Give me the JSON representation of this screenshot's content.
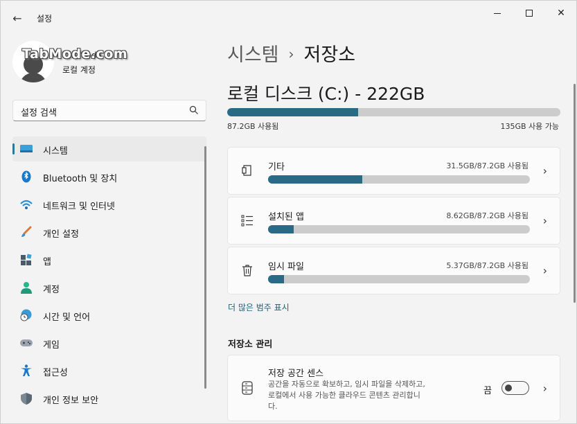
{
  "window": {
    "title": "설정",
    "back_glyph": "←",
    "close_glyph": "✕"
  },
  "profile": {
    "name": "Tab.Mode",
    "account_type": "로컬 계정",
    "watermark": "TabMode.com"
  },
  "search": {
    "placeholder": "설정 검색"
  },
  "sidebar": {
    "items": [
      {
        "label": "시스템",
        "icon": "monitor-icon",
        "active": true
      },
      {
        "label": "Bluetooth 및 장치",
        "icon": "bluetooth-icon"
      },
      {
        "label": "네트워크 및 인터넷",
        "icon": "wifi-icon"
      },
      {
        "label": "개인 설정",
        "icon": "brush-icon"
      },
      {
        "label": "앱",
        "icon": "apps-icon"
      },
      {
        "label": "계정",
        "icon": "person-icon"
      },
      {
        "label": "시간 및 언어",
        "icon": "globe-clock-icon"
      },
      {
        "label": "게임",
        "icon": "gamepad-icon"
      },
      {
        "label": "접근성",
        "icon": "accessibility-icon"
      },
      {
        "label": "개인 정보 보안",
        "icon": "shield-icon"
      }
    ]
  },
  "breadcrumb": {
    "parent": "시스템",
    "separator": "›",
    "current": "저장소"
  },
  "disk": {
    "title": "로컬 디스크 (C:) - 222GB",
    "used_label": "87.2GB 사용됨",
    "free_label": "135GB 사용 가능",
    "used_fraction": 0.393
  },
  "categories": [
    {
      "title": "기타",
      "usage": "31.5GB/87.2GB 사용됨",
      "fraction": 0.361,
      "icon": "document-icon"
    },
    {
      "title": "설치된 앱",
      "usage": "8.62GB/87.2GB 사용됨",
      "fraction": 0.099,
      "icon": "list-icon"
    },
    {
      "title": "임시 파일",
      "usage": "5.37GB/87.2GB 사용됨",
      "fraction": 0.062,
      "icon": "trash-icon"
    }
  ],
  "more_categories_label": "더 많은 범주 표시",
  "storage_management": {
    "section_title": "저장소 관리",
    "sense": {
      "title": "저장 공간 센스",
      "description": "공간을 자동으로 확보하고, 임시 파일을 삭제하고, 로컬에서 사용 가능한 클라우드 콘텐츠 관리합니다.",
      "toggle_label": "끔",
      "toggle_on": false
    }
  },
  "chevron_glyph": "›"
}
